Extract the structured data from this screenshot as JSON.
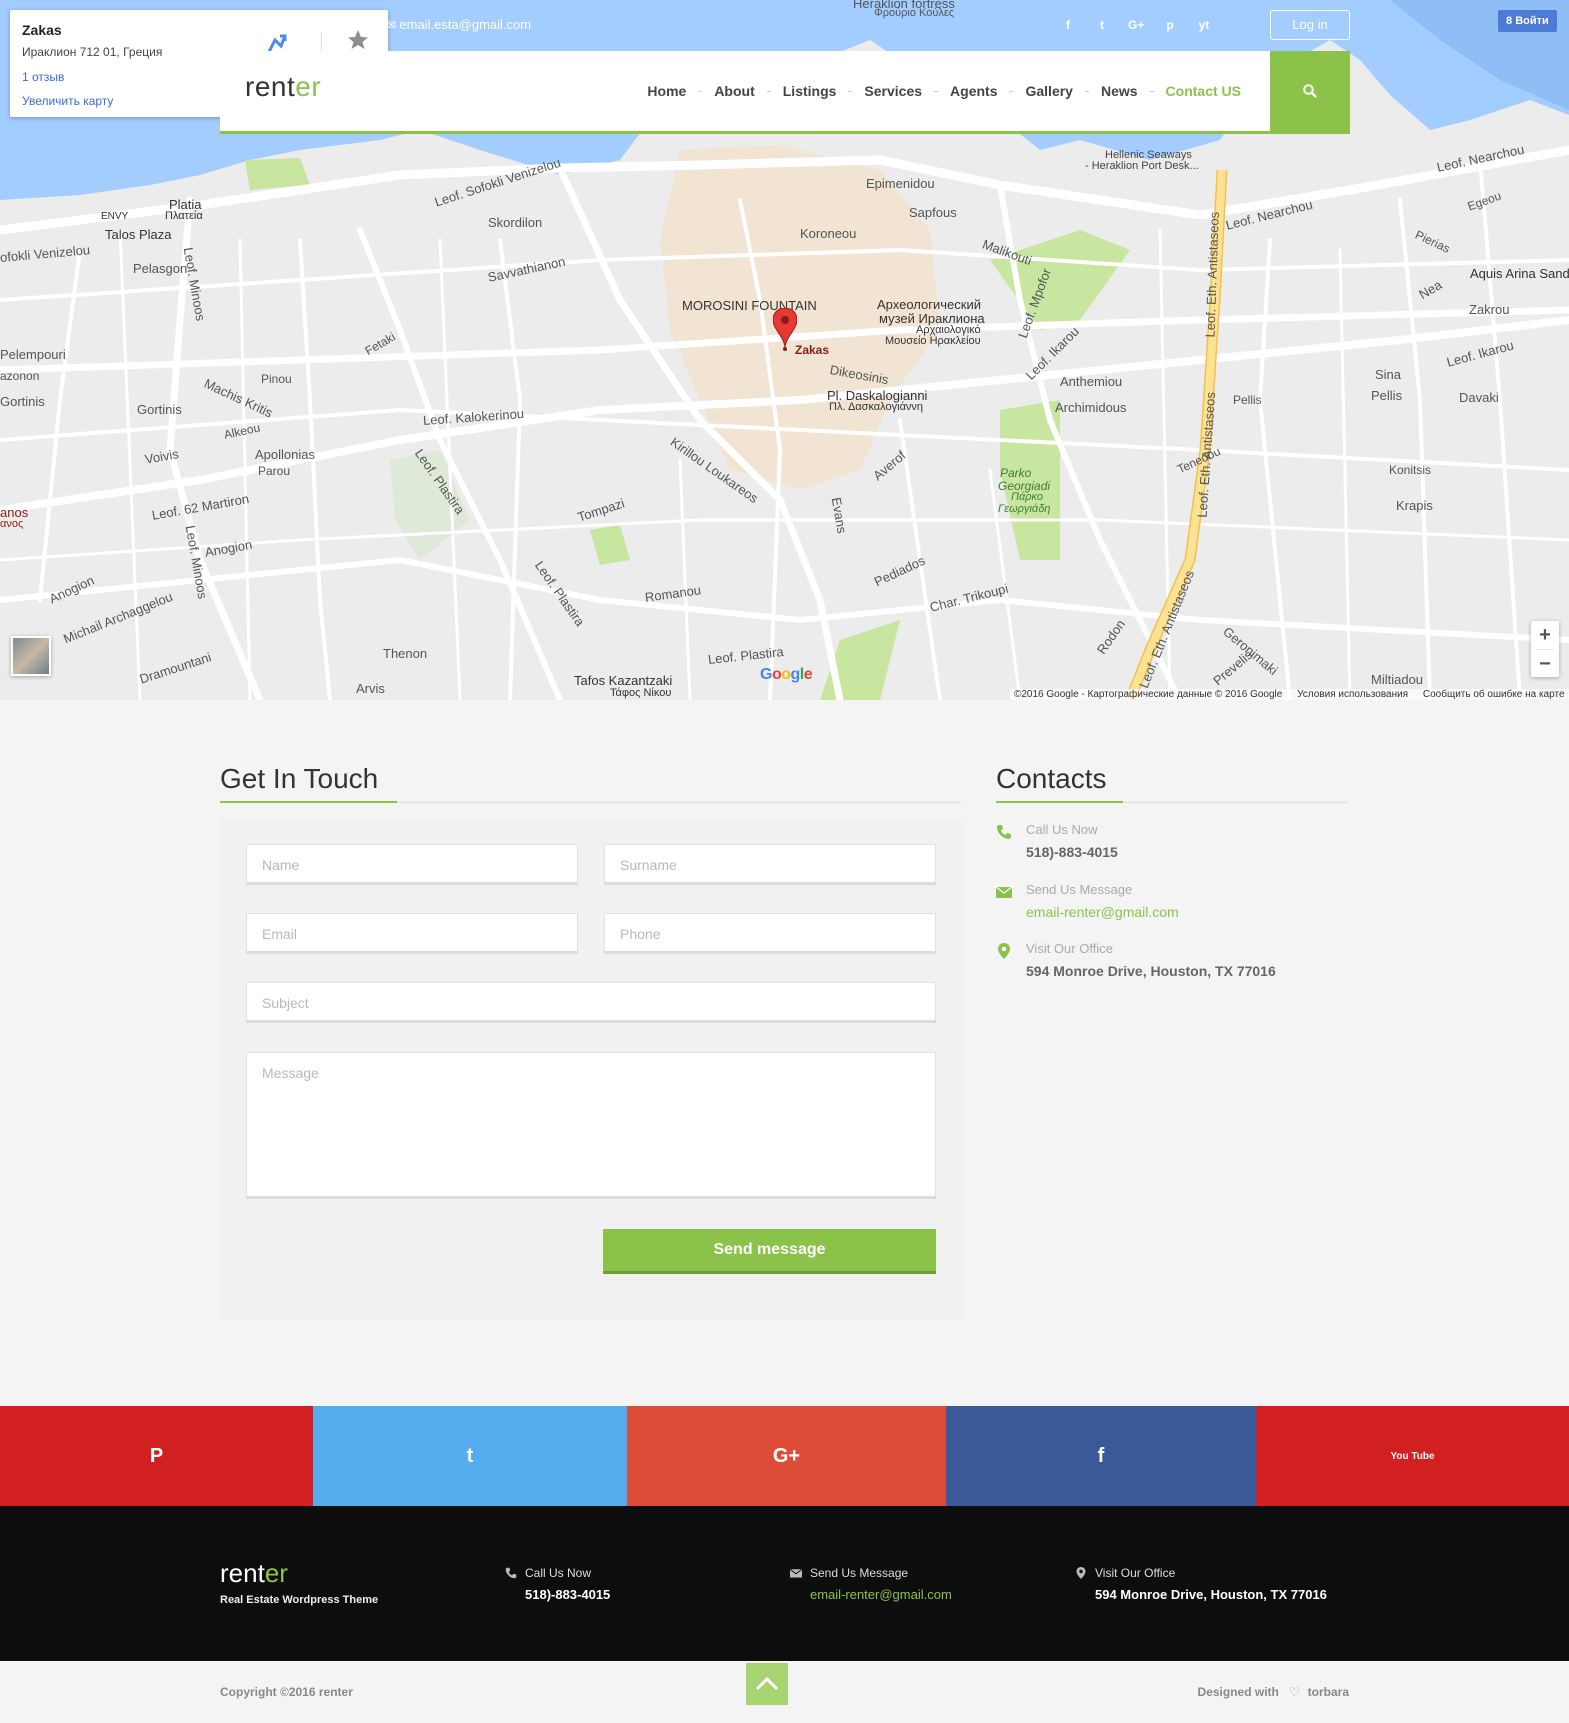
{
  "map": {
    "info_card": {
      "title": "Zakas",
      "address": "Ираклион 712 01, Греция",
      "reviews": "1 отзыв",
      "enlarge": "Увеличить карту"
    },
    "marker_label": "Zakas",
    "labels": {
      "heraklion_fortress": "Heraklion fortress",
      "frourio": "Φρούριο Κούλες",
      "hellenic_seaways": "Hellenic Seaways",
      "port_desk": "- Heraklion Port Desk...",
      "leof_nearchou": "Leof. Nearchou",
      "leof_nearchou_2": "Leof. Nearchou",
      "epimenidou": "Epimenidou",
      "sapfous": "Sapfous",
      "malikouti": "Malikouti",
      "koroneou": "Koroneou",
      "skordilon": "Skordilon",
      "savvathianon": "Savvathianon",
      "leof_sofokli": "Leof. Sofokli Venizelou",
      "sofokli_venizelou": "ofokli Venizelou",
      "platia": "Platia",
      "plateia": "Πλατεία",
      "envy": "ENVY",
      "talos_plaza": "Talos Plaza",
      "pelasgon": "Pelasgon",
      "morosini": "MOROSINI FOUNTAIN",
      "museum_ru_1": "Археологический",
      "museum_ru_2": "музей Ираклиона",
      "museum_gr_1": "Αρχαιολογικό",
      "museum_gr_2": "Μουσείο Ηρακλείου",
      "dikeosinis": "Dikeosinis",
      "daskalogianni": "Pl. Daskalogianni",
      "daskalogianni_gr": "Πλ. Δασκαλογιάννη",
      "leof_kalokerinou": "Leof. Kalokerinou",
      "leof_62_martiron": "Leof. 62 Martiron",
      "leof_ikarou": "Leof. Ikarou",
      "leof_ikarou_2": "Leof. Ikarou",
      "anthemiou": "Anthemiou",
      "archimidous": "Archimidous",
      "parko_georgiadi": "Parko",
      "parko_georgiadi_2": "Georgiadi",
      "parko_gr": "Πάρκο",
      "parko_gr_2": "Γεωργιάδη",
      "tompazi": "Tompazi",
      "pediados": "Pediados",
      "char_trikoupi": "Char. Trikoupi",
      "romanou": "Romanou",
      "thenon": "Thenon",
      "arvis": "Arvis",
      "anogion": "Anogion",
      "anogion_2": "Anogion",
      "apollonias": "Apollonias",
      "parou": "Parou",
      "voivis": "Voivis",
      "gortinis": "Gortinis",
      "gortinis_2": "Gortinis",
      "alkeou": "Alkeou",
      "pinou": "Pinou",
      "fetaki": "Fetaki",
      "tafos_kazantzaki": "Tafos Kazantzaki",
      "tafos_gr": "Τάφος Νίκου",
      "leof_plastira": "Leof. Plastira",
      "pellis": "Pellis",
      "sina": "Sina",
      "pellis_2": "Pellis",
      "davaki": "Davaki",
      "zakrou": "Zakrou",
      "nea": "Nea",
      "aquis": "Aquis Arina Sand",
      "konitsis": "Konitsis",
      "krapis": "Krapis",
      "tenedou": "Tenedou",
      "miltiadou": "Miltiadou",
      "gerominaki": "Geronimaki",
      "prevelis": "Prevelis",
      "rodon": "Rodon",
      "egeou": "Egeou",
      "pierias": "Pierias",
      "machis_kritis": "Machis Kritis",
      "pelempouri": "Pelempouri",
      "azonon": "azonon",
      "gortinis_3": "Gortinis",
      "anos": "anos",
      "avos": "ανος",
      "mihail": "Michail Archaggelou",
      "dramountani": "Dramountani",
      "leof_eth_antistaseos": "Leof. Eth. Antistaseos",
      "leof_eth_antistaseos_2": "Leof. Eth. Antistaseos",
      "leof_eth_antistaseos_3": "Leof. Eth. Antistaseos",
      "leof_mporf": "Leof. Mpofor",
      "evans": "Evans",
      "averof": "Averof",
      "kirillou": "Kirillou Loukareos",
      "leof_plastira_2": "Leof. Plastira",
      "leof_plastira_3": "Leof. Plastira",
      "leof_minoos": "Leof. Minoos",
      "leof_minoos_2": "Leof. Minoos"
    },
    "attribution": [
      "©2016 Google - Картографические данные © 2016 Google",
      "Условия использования",
      "Сообщить об ошибке на карте"
    ],
    "google_logo": "Google",
    "zoom_in": "+",
    "zoom_out": "−"
  },
  "topbar": {
    "email": "email.esta@gmail.com",
    "login": "Log in",
    "vk_login": "Войти",
    "social": [
      "f",
      "t",
      "G+",
      "p",
      "yt"
    ]
  },
  "header": {
    "logo_main": "rent",
    "logo_accent": "er",
    "nav": [
      "Home",
      "About",
      "Listings",
      "Services",
      "Agents",
      "Gallery",
      "News",
      "Contact US"
    ],
    "active_nav": "Contact US"
  },
  "contact_form": {
    "title": "Get In Touch",
    "name_placeholder": "Name",
    "surname_placeholder": "Surname",
    "email_placeholder": "Email",
    "phone_placeholder": "Phone",
    "subject_placeholder": "Subject",
    "message_placeholder": "Message",
    "submit": "Send message"
  },
  "contacts": {
    "title": "Contacts",
    "call_label": "Call Us Now",
    "call_value": "518)-883-4015",
    "message_label": "Send Us Message",
    "message_value": "email-renter@gmail.com",
    "office_label": "Visit Our Office",
    "office_value": "594 Monroe Drive, Houston, TX 77016"
  },
  "social_strip": [
    {
      "name": "pinterest",
      "glyph": "P",
      "color": "#d21f1f"
    },
    {
      "name": "twitter",
      "glyph": "t",
      "color": "#55acee"
    },
    {
      "name": "google-plus",
      "glyph": "G+",
      "color": "#dd4b39"
    },
    {
      "name": "facebook",
      "glyph": "f",
      "color": "#3b5998"
    },
    {
      "name": "youtube",
      "glyph": "You Tube",
      "color": "#d21f1f"
    }
  ],
  "footer": {
    "logo_main": "rent",
    "logo_accent": "er",
    "tagline": "Real Estate Wordpress Theme",
    "call_label": "Call Us Now",
    "call_value": "518)-883-4015",
    "message_label": "Send Us Message",
    "message_value": "email-renter@gmail.com",
    "office_label": "Visit Our Office",
    "office_value": "594 Monroe Drive, Houston, TX 77016"
  },
  "bottom": {
    "copyright": "Copyright ©2016 renter",
    "designed_prefix": "Designed with",
    "designed_by": "torbara"
  },
  "colors": {
    "accent": "#8bc34a",
    "water": "#a3ccff",
    "park": "#c8e6a0",
    "highway": "#fde293"
  }
}
